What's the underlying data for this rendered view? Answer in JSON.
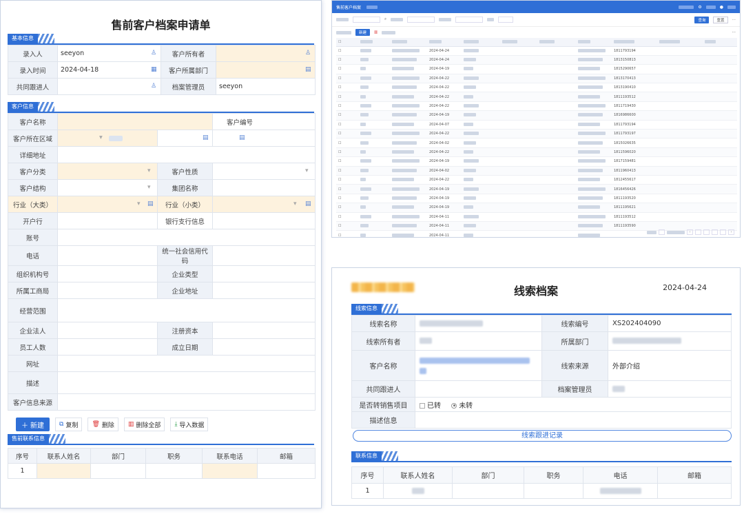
{
  "left_form": {
    "title": "售前客户档案申请单",
    "section_basic": "基本信息",
    "basic_rows": [
      {
        "l1": "录入人",
        "v1": "seeyon",
        "l2": "客户所有者",
        "v2": ""
      },
      {
        "l1": "录入时间",
        "v1": "2024-04-18",
        "l2": "客户所属部门",
        "v2": ""
      },
      {
        "l1": "共同跟进人",
        "v1": "",
        "l2": "档案管理员",
        "v2": "seeyon"
      }
    ],
    "section_customer": "客户信息",
    "labels": {
      "customer_name": "客户名称",
      "customer_no": "客户编号",
      "region": "客户所在区域",
      "address": "详细地址",
      "category": "客户分类",
      "nature": "客户性质",
      "structure": "客户结构",
      "group_name": "集团名称",
      "industry_big": "行业（大类）",
      "industry_small": "行业（小类）",
      "bank": "开户行",
      "bank_branch": "银行支行信息",
      "account": "账号",
      "phone": "电话",
      "credit_code": "统一社会信用代码",
      "org_code": "组织机构号",
      "enterprise_type": "企业类型",
      "tax_bureau": "所属工商局",
      "enterprise_addr": "企业地址",
      "business_scope": "经营范围",
      "legal_person": "企业法人",
      "reg_capital": "注册资本",
      "employees": "员工人数",
      "founded": "成立日期",
      "website": "网址",
      "description": "描述",
      "source": "客户信息来源"
    },
    "toolbar": {
      "new": "新建",
      "copy": "复制",
      "delete": "删除",
      "delete_all": "删除全部",
      "import": "导入数据"
    },
    "section_contacts": "售前联系信息",
    "contact_headers": [
      "序号",
      "联系人姓名",
      "部门",
      "职务",
      "联系电话",
      "邮箱"
    ],
    "contact_rows": [
      [
        "1",
        "",
        "",
        "",
        "",
        ""
      ]
    ]
  },
  "list_panel": {
    "header_title": "售前客户档案",
    "toolbar": {
      "new": "新建",
      "query": "查询",
      "reset": "重置"
    },
    "dates": [
      "2024-04-24",
      "2024-04-24",
      "2024-04-19",
      "2024-04-22",
      "2024-04-22",
      "2024-04-22",
      "2024-04-22",
      "2024-04-19",
      "2024-04-07",
      "2024-04-22",
      "2024-04-02",
      "2024-04-22",
      "2024-04-19",
      "2024-04-02",
      "2024-04-22",
      "2024-04-19",
      "2024-04-19",
      "2024-04-19",
      "2024-04-11",
      "2024-04-11",
      "2024-04-11"
    ],
    "codes": [
      "1811793194",
      "1813150813",
      "1815290657",
      "1813170413",
      "1813190410",
      "1811193512",
      "1811719430",
      "1816986600",
      "1811793194",
      "1811793197",
      "1815026635",
      "1811596020",
      "1817159481",
      "1811960413",
      "1812455617",
      "1816456426",
      "1811193520",
      "1811195621",
      "1811193512",
      "1811193590"
    ]
  },
  "clue_panel": {
    "title": "线索档案",
    "date": "2024-04-24",
    "section_info": "线索信息",
    "labels": {
      "clue_name": "线索名称",
      "clue_no": "线索编号",
      "owner": "线索所有者",
      "dept": "所属部门",
      "customer": "客户名称",
      "source": "线索来源",
      "co_follower": "共同跟进人",
      "archive_admin": "档案管理员",
      "converted": "是否转销售项目",
      "description": "描述信息"
    },
    "values": {
      "clue_no": "XS202404090",
      "source": "外部介绍",
      "converted_yes": "已转",
      "converted_no": "未转"
    },
    "progress_button": "线索跟进记录",
    "section_contact": "联系信息",
    "contact_headers": [
      "序号",
      "联系人姓名",
      "部门",
      "职务",
      "电话",
      "邮箱"
    ],
    "contact_rows": [
      [
        "1",
        "",
        "",
        "",
        "",
        ""
      ]
    ]
  }
}
